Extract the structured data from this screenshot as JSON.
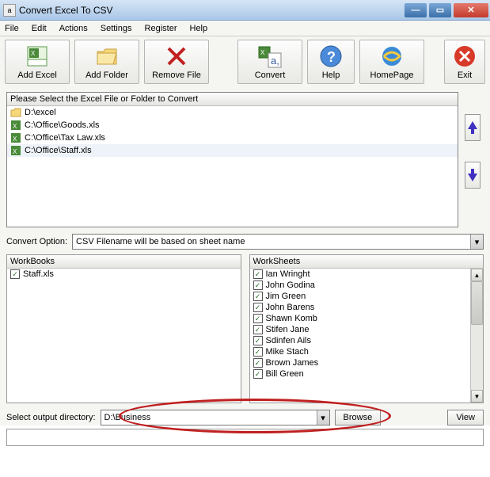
{
  "window": {
    "title": "Convert Excel To CSV"
  },
  "menu": {
    "file": "File",
    "edit": "Edit",
    "actions": "Actions",
    "settings": "Settings",
    "register": "Register",
    "help": "Help"
  },
  "toolbar": {
    "add_excel": "Add Excel",
    "add_folder": "Add Folder",
    "remove_file": "Remove File",
    "convert": "Convert",
    "help": "Help",
    "homepage": "HomePage",
    "exit": "Exit"
  },
  "filelist": {
    "header": "Please Select the Excel File or Folder to Convert",
    "items": [
      {
        "type": "folder",
        "path": "D:\\excel"
      },
      {
        "type": "xls",
        "path": "C:\\Office\\Goods.xls"
      },
      {
        "type": "xls",
        "path": "C:\\Office\\Tax Law.xls"
      },
      {
        "type": "xls",
        "path": "C:\\Office\\Staff.xls"
      }
    ]
  },
  "convert_option": {
    "label": "Convert Option:",
    "value": "CSV Filename will be based on sheet name"
  },
  "workbooks": {
    "header": "WorkBooks",
    "items": [
      "Staff.xls"
    ]
  },
  "worksheets": {
    "header": "WorkSheets",
    "items": [
      "Ian Wringht",
      "John Godina",
      "Jim Green",
      "John Barens",
      "Shawn Komb",
      "Stifen Jane",
      "Sdinfen Ails",
      "Mike Stach",
      "Brown James",
      "Bill Green"
    ]
  },
  "output": {
    "label": "Select  output directory:",
    "path": "D:\\Business",
    "browse": "Browse",
    "view": "View"
  }
}
